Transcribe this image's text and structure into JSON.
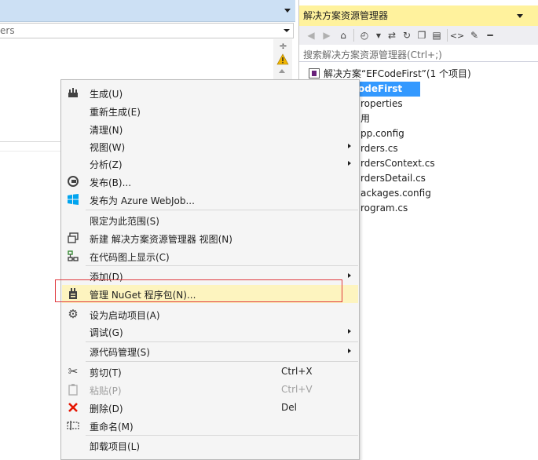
{
  "left_panel": {
    "combo_text": "ers"
  },
  "solution_explorer": {
    "title": "解决方案资源管理器",
    "search_placeholder": "搜索解决方案资源管理器(Ctrl+;)",
    "solution_label": "解决方案“EFCodeFirst”(1 个项目)",
    "tree_items": [
      "odeFirst",
      "roperties",
      "用",
      "pp.config",
      "rders.cs",
      "rdersContext.cs",
      "rdersDetail.cs",
      "ackages.config",
      "rogram.cs"
    ]
  },
  "context_menu": {
    "items": [
      {
        "label": "生成(U)",
        "icon": "build-icon"
      },
      {
        "label": "重新生成(E)"
      },
      {
        "label": "清理(N)"
      },
      {
        "label": "视图(W)",
        "submenu": true
      },
      {
        "label": "分析(Z)",
        "submenu": true
      },
      {
        "label": "发布(B)...",
        "icon": "publish-icon"
      },
      {
        "label": "发布为 Azure WebJob...",
        "icon": "windows-icon"
      },
      {
        "label": "限定为此范围(S)"
      },
      {
        "label": "新建 解决方案资源管理器 视图(N)",
        "icon": "new-view-icon"
      },
      {
        "label": "在代码图上显示(C)",
        "icon": "code-map-icon"
      },
      {
        "label": "添加(D)",
        "submenu": true
      },
      {
        "label": "管理 NuGet 程序包(N)...",
        "icon": "nuget-icon"
      },
      {
        "label": "设为启动项目(A)",
        "icon": "gear-icon"
      },
      {
        "label": "调试(G)",
        "submenu": true
      },
      {
        "label": "源代码管理(S)",
        "submenu": true
      },
      {
        "label": "剪切(T)",
        "shortcut": "Ctrl+X",
        "icon": "cut-icon"
      },
      {
        "label": "粘贴(P)",
        "shortcut": "Ctrl+V",
        "icon": "paste-icon",
        "disabled": true
      },
      {
        "label": "删除(D)",
        "shortcut": "Del",
        "icon": "delete-icon"
      },
      {
        "label": "重命名(M)",
        "icon": "rename-icon"
      },
      {
        "label": "卸载项目(L)"
      }
    ]
  },
  "colors": {
    "se_title_bg": "#fff29d",
    "highlight_bg": "#fdf4bf",
    "selected_bg": "#3399ff",
    "outline": "#e0393e",
    "delete_red": "#e51400",
    "windows_blue": "#00a4ef"
  }
}
